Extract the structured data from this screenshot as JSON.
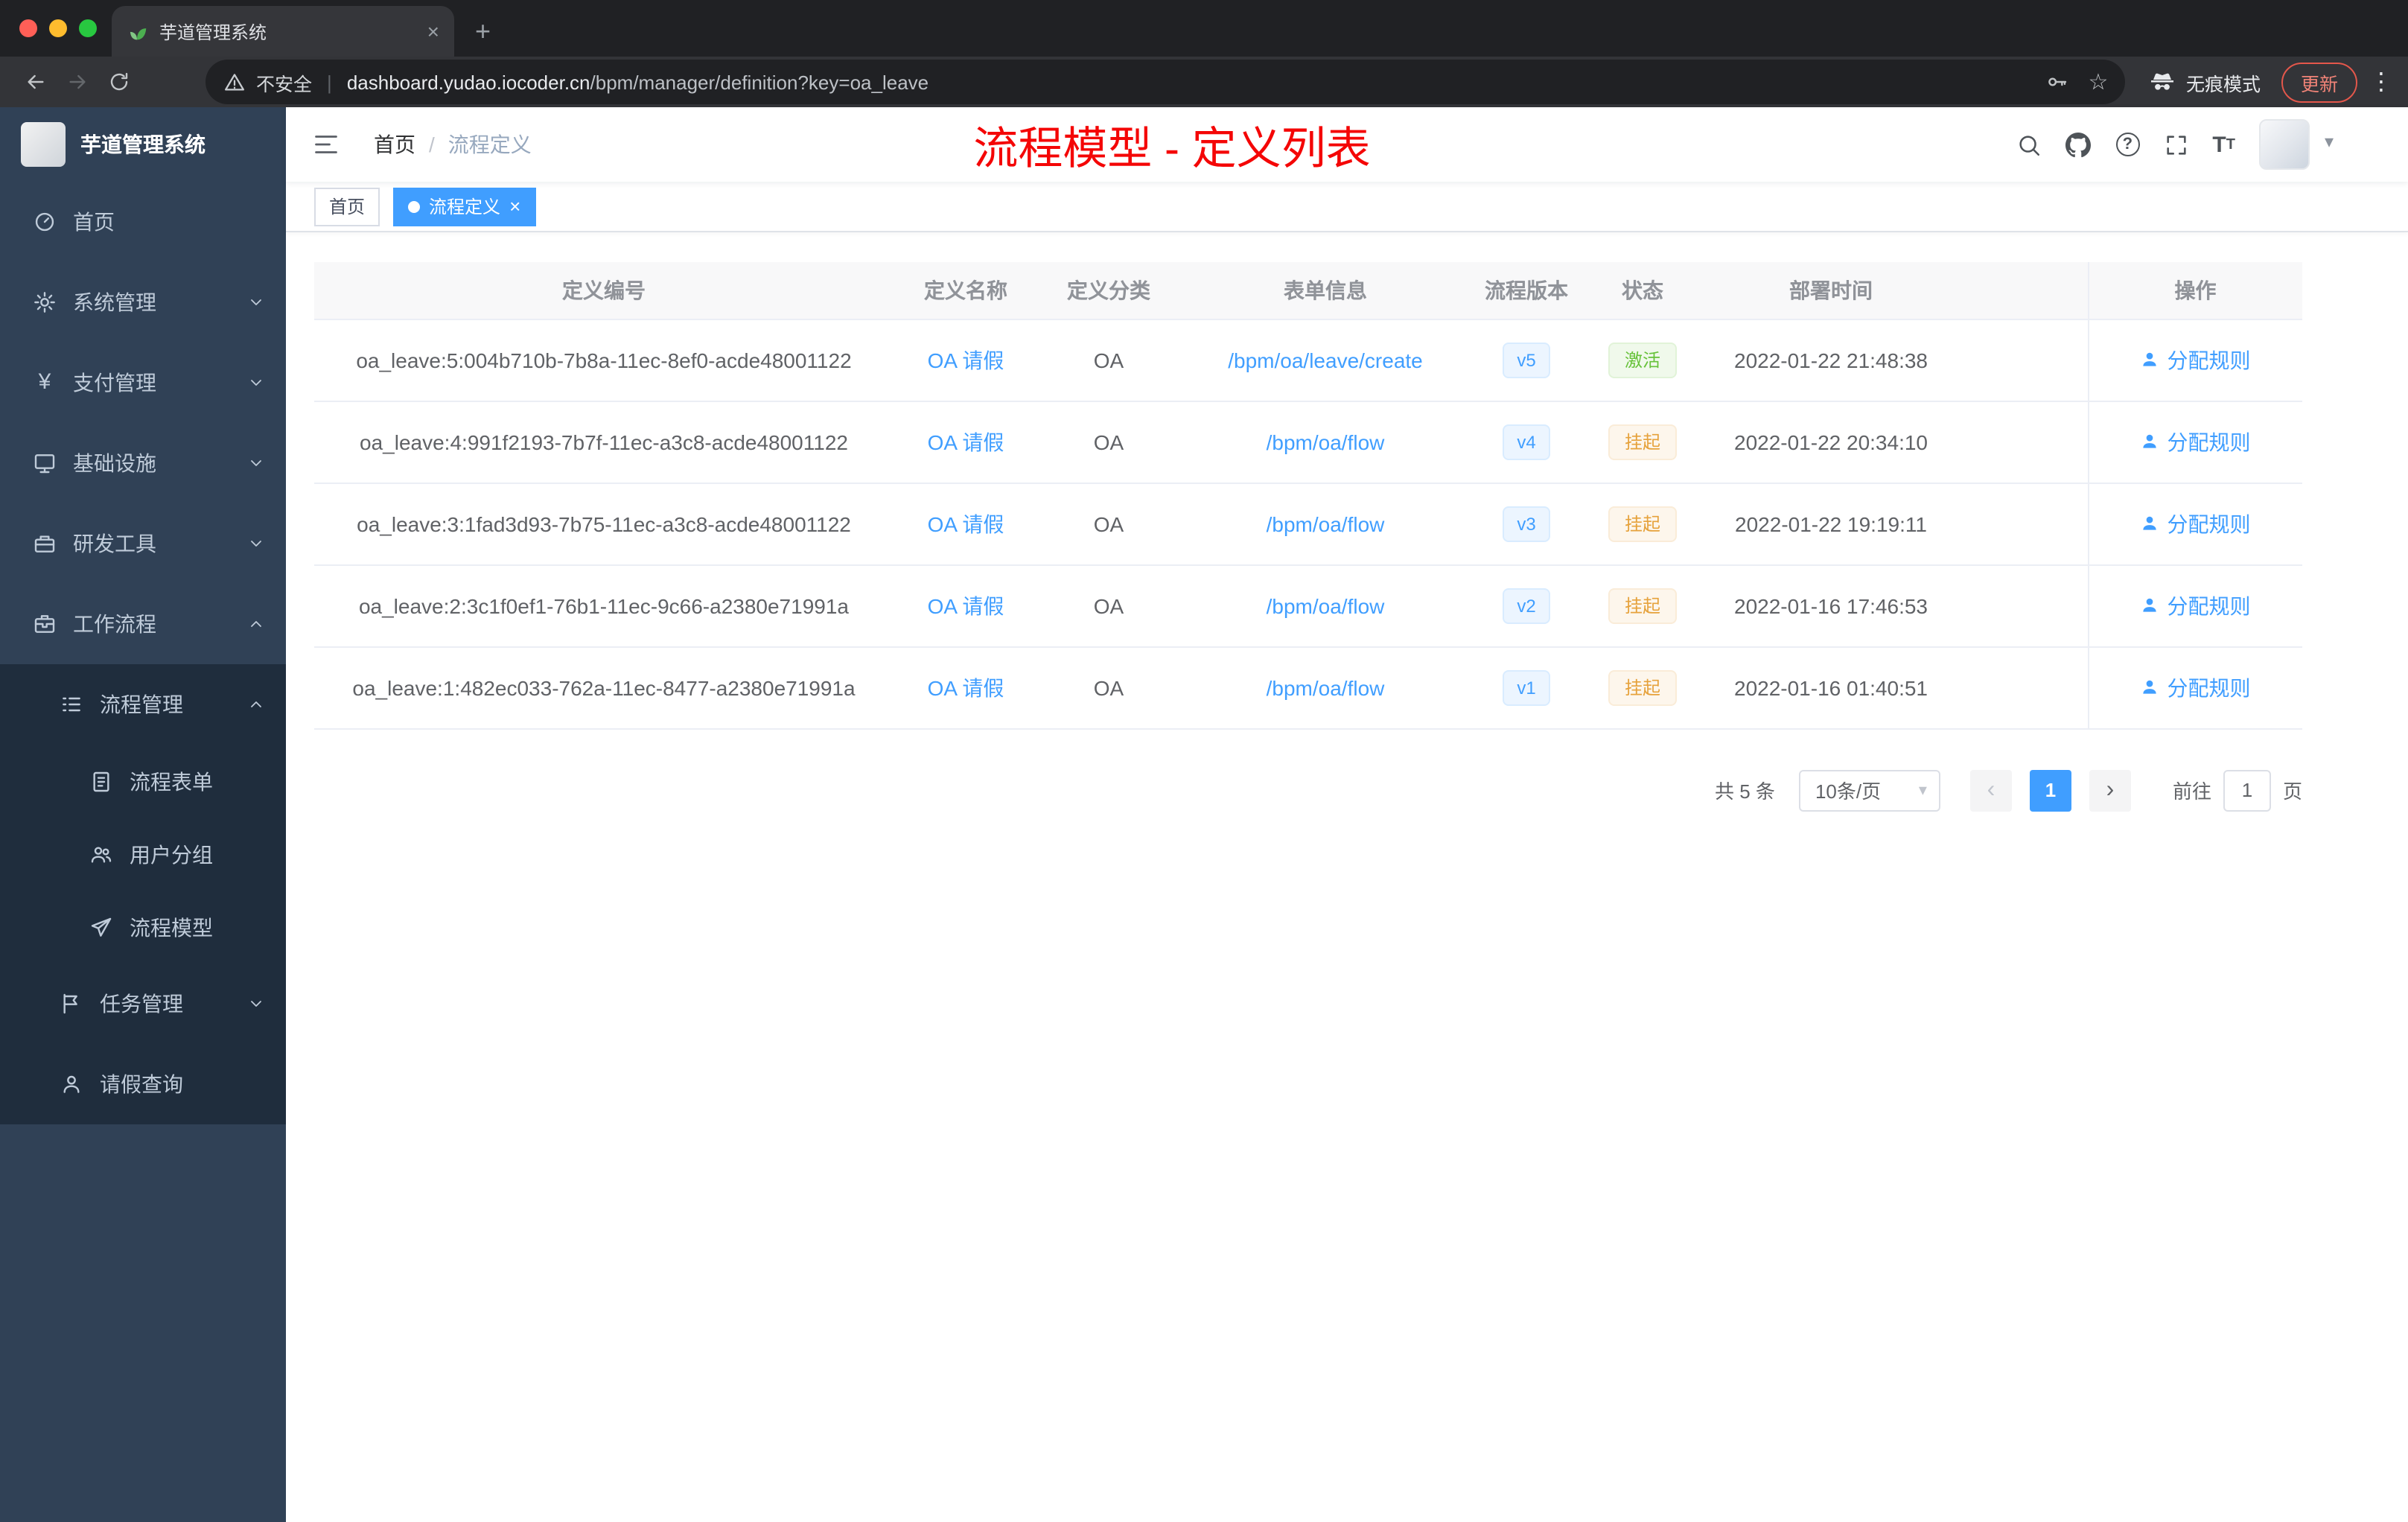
{
  "colors": {
    "accent": "#409eff",
    "success": "#67c23a",
    "warning": "#e6a23c",
    "annotation_red": "#f40606",
    "sidebar_bg": "#304156",
    "sidebar_submenu_bg": "#1f2d3d"
  },
  "browser": {
    "tab": {
      "title": "芋道管理系统"
    },
    "address": {
      "security_label": "不安全",
      "url_host": "dashboard.yudao.iocoder.cn",
      "url_path": "/bpm/manager/definition?key=oa_leave",
      "incognito_label": "无痕模式",
      "update_label": "更新"
    }
  },
  "glyphs": {
    "close": "×",
    "new_tab": "+",
    "kebab": "⋮",
    "star": "☆",
    "caret_down": "▾",
    "slash": "/",
    "divider": "|",
    "question": "?",
    "t_big": "T",
    "t_small": "T",
    "prev": "‹",
    "next": "›"
  },
  "sidebar": {
    "logo_title": "芋道管理系统",
    "items": {
      "home": "首页",
      "system": "系统管理",
      "payment": "支付管理",
      "infra": "基础设施",
      "devtools": "研发工具",
      "workflow": "工作流程",
      "process_mgmt": "流程管理",
      "process_form": "流程表单",
      "user_group": "用户分组",
      "process_model": "流程模型",
      "task_mgmt": "任务管理",
      "leave_query": "请假查询"
    }
  },
  "header": {
    "breadcrumb_home": "首页",
    "breadcrumb_current": "流程定义",
    "annotation": "流程模型 - 定义列表"
  },
  "tags": {
    "home": "首页",
    "active": "流程定义"
  },
  "table": {
    "columns": {
      "id": "定义编号",
      "name": "定义名称",
      "category": "定义分类",
      "form": "表单信息",
      "version": "流程版本",
      "status": "状态",
      "deploy_time": "部署时间",
      "action": "操作"
    },
    "rows": [
      {
        "id": "oa_leave:5:004b710b-7b8a-11ec-8ef0-acde48001122",
        "name": "OA 请假",
        "category": "OA",
        "form": "/bpm/oa/leave/create",
        "version": "v5",
        "status": "激活",
        "deploy_time": "2022-01-22 21:48:38",
        "action": "分配规则"
      },
      {
        "id": "oa_leave:4:991f2193-7b7f-11ec-a3c8-acde48001122",
        "name": "OA 请假",
        "category": "OA",
        "form": "/bpm/oa/flow",
        "version": "v4",
        "status": "挂起",
        "deploy_time": "2022-01-22 20:34:10",
        "action": "分配规则"
      },
      {
        "id": "oa_leave:3:1fad3d93-7b75-11ec-a3c8-acde48001122",
        "name": "OA 请假",
        "category": "OA",
        "form": "/bpm/oa/flow",
        "version": "v3",
        "status": "挂起",
        "deploy_time": "2022-01-22 19:19:11",
        "action": "分配规则"
      },
      {
        "id": "oa_leave:2:3c1f0ef1-76b1-11ec-9c66-a2380e71991a",
        "name": "OA 请假",
        "category": "OA",
        "form": "/bpm/oa/flow",
        "version": "v2",
        "status": "挂起",
        "deploy_time": "2022-01-16 17:46:53",
        "action": "分配规则"
      },
      {
        "id": "oa_leave:1:482ec033-762a-11ec-8477-a2380e71991a",
        "name": "OA 请假",
        "category": "OA",
        "form": "/bpm/oa/flow",
        "version": "v1",
        "status": "挂起",
        "deploy_time": "2022-01-16 01:40:51",
        "action": "分配规则"
      }
    ]
  },
  "pagination": {
    "total": "共 5 条",
    "page_size": "10条/页",
    "page": "1",
    "goto_label": "前往",
    "goto_value": "1",
    "unit": "页"
  }
}
